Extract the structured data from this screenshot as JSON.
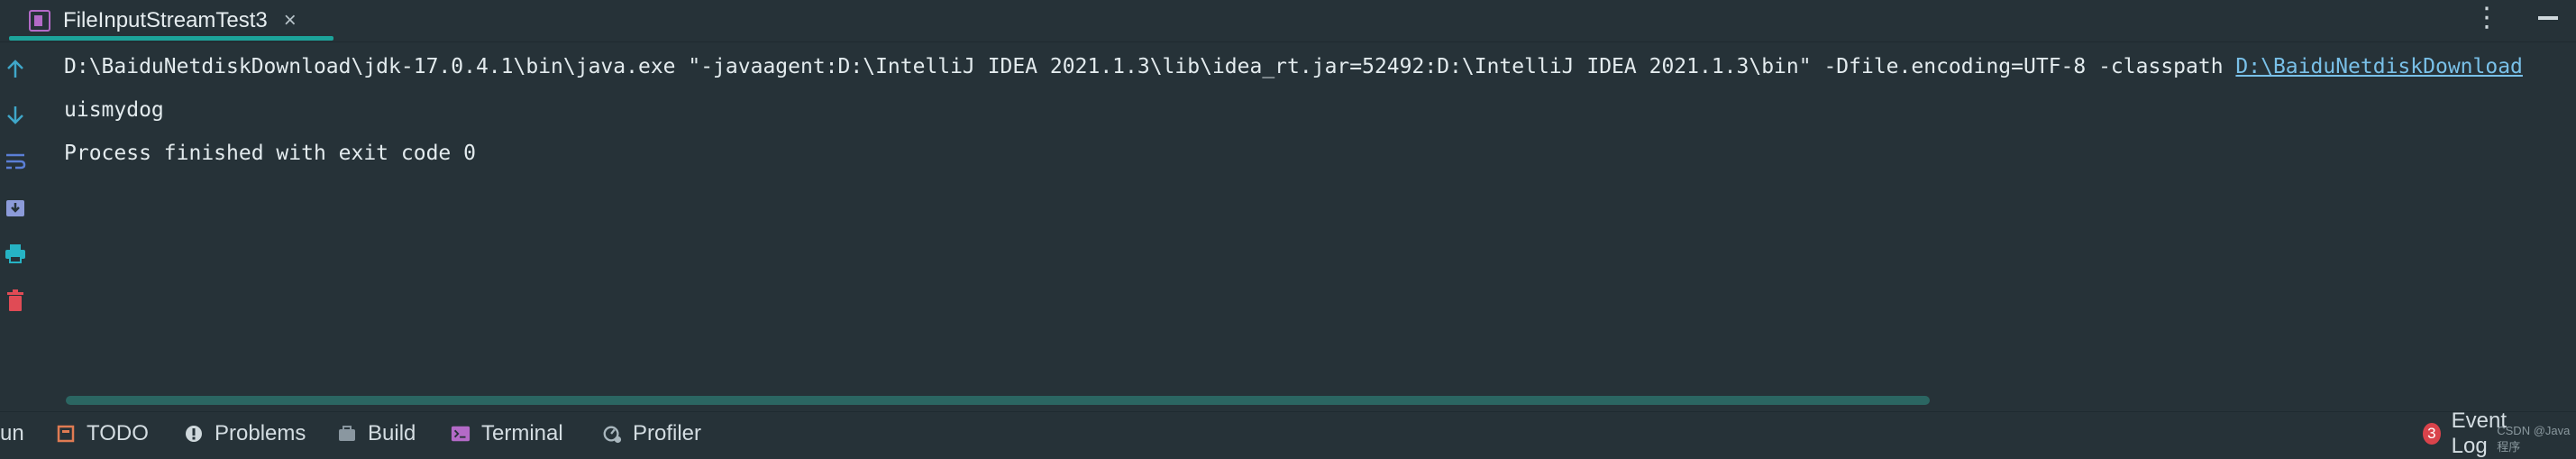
{
  "tab": {
    "label": "FileInputStreamTest3",
    "close": "×"
  },
  "console": {
    "line1_prefix": "D:\\BaiduNetdiskDownload\\jdk-17.0.4.1\\bin\\java.exe \"-javaagent:D:\\IntelliJ IDEA 2021.1.3\\lib\\idea_rt.jar=52492:D:\\IntelliJ IDEA 2021.1.3\\bin\" -Dfile.encoding=UTF-8 -classpath ",
    "line1_link": "D:\\BaiduNetdiskDownload",
    "line2": "uismydog",
    "line3": "Process finished with exit code 0"
  },
  "toolbar": {
    "run": "un",
    "todo": "TODO",
    "problems": "Problems",
    "build": "Build",
    "terminal": "Terminal",
    "profiler": "Profiler",
    "event_log": "Event Log",
    "event_count": "3",
    "watermark": "CSDN @Java程序"
  },
  "colors": {
    "background": "#263238",
    "accent": "#1ca39a",
    "link": "#79c0e8",
    "badge": "#d9434b"
  }
}
